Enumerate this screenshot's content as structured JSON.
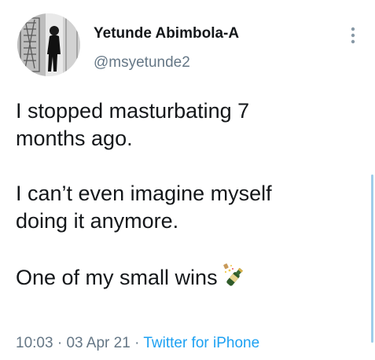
{
  "tweet": {
    "display_name": "Yetunde Abimbola-A",
    "handle": "@msyetunde2",
    "paragraphs": [
      [
        "I stopped masturbating 7",
        "months ago."
      ],
      [
        "I can’t even imagine myself",
        "doing it anymore."
      ],
      [
        "One of my small wins"
      ]
    ],
    "emoji": "bottle-with-popping-cork",
    "time": "10:03",
    "separator": "·",
    "date": "03 Apr 21",
    "source": "Twitter for iPhone"
  },
  "colors": {
    "text": "#14171a",
    "secondary": "#657786",
    "link": "#1da1f2"
  },
  "icons": {
    "menu": "more-vertical-icon"
  }
}
